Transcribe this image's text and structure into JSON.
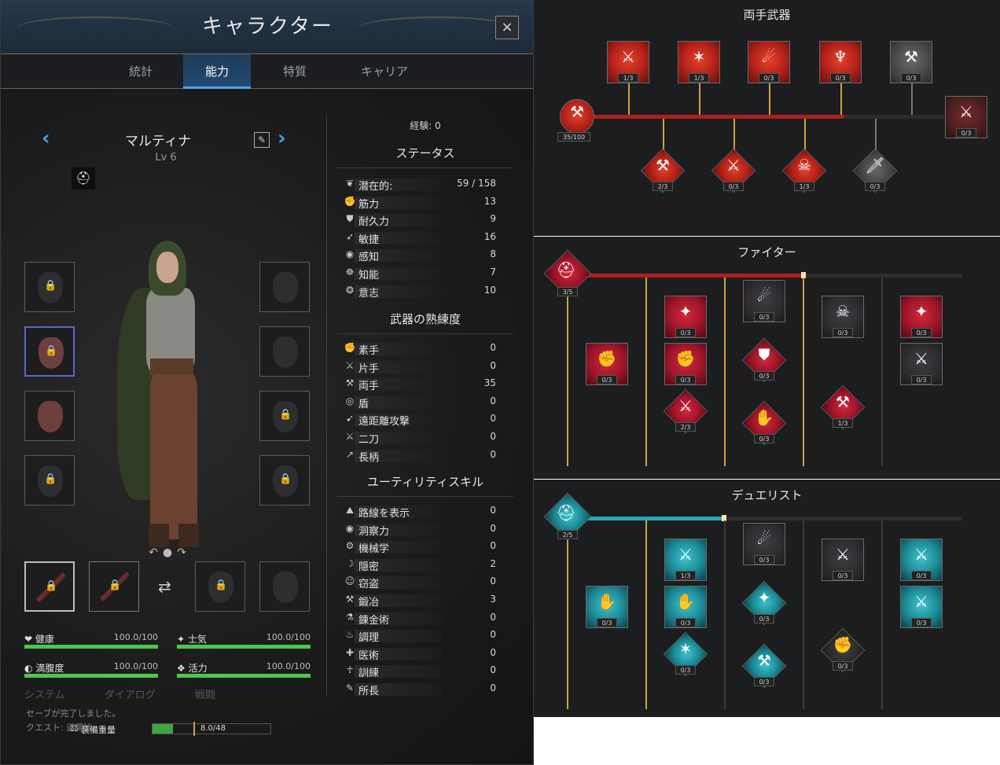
{
  "window": {
    "title": "キャラクター",
    "close": "×"
  },
  "tabs": [
    "統計",
    "能力",
    "特質",
    "キャリア"
  ],
  "character": {
    "name": "マルティナ",
    "level": "Lv 6",
    "nav_prev": "‹",
    "nav_next": "›",
    "helmet_badge": "⛑",
    "edit_icon": "✎",
    "rotate": "↶●↷",
    "swap": "⇄"
  },
  "bars": [
    {
      "label": "健康",
      "value": "100.0/100",
      "icon": "❤",
      "fill": 1.0
    },
    {
      "label": "士気",
      "value": "100.0/100",
      "icon": "✦",
      "fill": 1.0
    },
    {
      "label": "満腹度",
      "value": "100.0/100",
      "icon": "◐",
      "fill": 1.0
    },
    {
      "label": "活力",
      "value": "100.0/100",
      "icon": "❖",
      "fill": 1.0
    }
  ],
  "log": {
    "tabs": [
      "システム",
      "ダイアログ",
      "戦闘"
    ],
    "line1": "セーブが完了しました。",
    "line2": "クエスト: 道開始",
    "weight_label": "装備重量",
    "weight_icon": "⚖",
    "weight_value": "8.0/48",
    "weight_fill": 0.17
  },
  "stats": {
    "exp": "経験: 0",
    "status_title": "ステータス",
    "status": [
      {
        "icon": "❦",
        "label": "潜在的:",
        "value": "59 / 158"
      },
      {
        "icon": "✊",
        "label": "筋力",
        "value": "13"
      },
      {
        "icon": "⛊",
        "label": "耐久力",
        "value": "9"
      },
      {
        "icon": "➶",
        "label": "敏捷",
        "value": "16"
      },
      {
        "icon": "◉",
        "label": "感知",
        "value": "8"
      },
      {
        "icon": "☸",
        "label": "知能",
        "value": "7"
      },
      {
        "icon": "❂",
        "label": "意志",
        "value": "10"
      }
    ],
    "weapons_title": "武器の熟練度",
    "weapons": [
      {
        "icon": "✊",
        "label": "素手",
        "value": "0"
      },
      {
        "icon": "⚔",
        "label": "片手",
        "value": "0"
      },
      {
        "icon": "⚒",
        "label": "両手",
        "value": "35"
      },
      {
        "icon": "◎",
        "label": "盾",
        "value": "0"
      },
      {
        "icon": "➹",
        "label": "遠距離攻撃",
        "value": "0"
      },
      {
        "icon": "⚔",
        "label": "二刀",
        "value": "0"
      },
      {
        "icon": "↗",
        "label": "長柄",
        "value": "0"
      }
    ],
    "utility_title": "ユーティリティスキル",
    "utility": [
      {
        "icon": "⛰",
        "label": "路線を表示",
        "value": "0"
      },
      {
        "icon": "◉",
        "label": "洞察力",
        "value": "0"
      },
      {
        "icon": "⚙",
        "label": "機械学",
        "value": "0"
      },
      {
        "icon": "☽",
        "label": "隠密",
        "value": "2"
      },
      {
        "icon": "☺",
        "label": "窃盗",
        "value": "0"
      },
      {
        "icon": "⚒",
        "label": "鍛冶",
        "value": "3"
      },
      {
        "icon": "⚗",
        "label": "錬金術",
        "value": "0"
      },
      {
        "icon": "♨",
        "label": "調理",
        "value": "0"
      },
      {
        "icon": "✚",
        "label": "医術",
        "value": "0"
      },
      {
        "icon": "☥",
        "label": "訓練",
        "value": "0"
      },
      {
        "icon": "✎",
        "label": "所長",
        "value": "0"
      }
    ]
  },
  "trees": {
    "two_hand": {
      "title": "両手武器",
      "root_rank": "35/100",
      "progress": 0.5,
      "top": [
        "1/3",
        "1/3",
        "0/3",
        "0/3",
        "0/3"
      ],
      "bottom": [
        "2/3",
        "0/3",
        "1/3",
        "0/3"
      ],
      "end": "0/3"
    },
    "fighter": {
      "title": "ファイター",
      "root_rank": "3/5",
      "progress": 0.6,
      "skills": [
        "0/3",
        "0/3",
        "2/3",
        "0/3",
        "0/3",
        "0/3",
        "0/3",
        "1/3",
        "0/3",
        "0/3",
        "0/3"
      ]
    },
    "duelist": {
      "title": "デュエリスト",
      "root_rank": "2/5",
      "progress": 0.4,
      "skills": [
        "0/3",
        "1/3",
        "0/3",
        "0/3",
        "0/3",
        "0/3",
        "0/3",
        "0/3",
        "0/3",
        "0/3",
        "0/3"
      ]
    }
  },
  "colors": {
    "accent": "#4fa3e8",
    "health": "#4cc74c",
    "red_line": "#b01e1e",
    "teal_line": "#2aa6b4"
  }
}
